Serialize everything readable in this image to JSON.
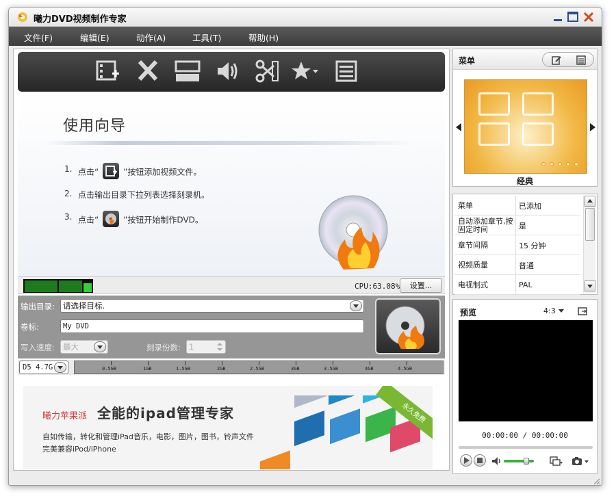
{
  "window": {
    "title": "曦力DVD视频制作专家"
  },
  "menubar": {
    "items": [
      {
        "label": "文件(F)"
      },
      {
        "label": "编辑(E)"
      },
      {
        "label": "动作(A)"
      },
      {
        "label": "工具(T)"
      },
      {
        "label": "帮助(H)"
      }
    ]
  },
  "toolbar": {
    "icons": [
      "add-video-icon",
      "delete-icon",
      "subtitle-icon",
      "audio-icon",
      "clip-icon",
      "effect-icon",
      "chapter-list-icon"
    ]
  },
  "guide": {
    "title": "使用向导",
    "steps": [
      {
        "num": "1.",
        "before": "点击“",
        "after": "”按钮添加视频文件。"
      },
      {
        "num": "2.",
        "text": "点击输出目录下拉列表选择刻录机。"
      },
      {
        "num": "3.",
        "before": "点击“",
        "after": "”按钮开始制作DVD。"
      }
    ]
  },
  "status": {
    "cpu_label": "CPU:63.08%",
    "settings_label": "设置..."
  },
  "output": {
    "dir_label": "输出目录:",
    "dir_value": "请选择目标.",
    "volume_label": "卷标:",
    "volume_value": "My DVD",
    "speed_label": "写入速度:",
    "speed_value": "最大",
    "copies_label": "刻录份数:",
    "copies_value": "1"
  },
  "capacity": {
    "disc_type": "D5 4.7G",
    "ticks": [
      "0.5GB",
      "1GB",
      "1.5GB",
      "2GB",
      "2.5GB",
      "3GB",
      "3.5GB",
      "4GB",
      "4.5GB"
    ]
  },
  "ad": {
    "brand": "曦力苹果派",
    "headline": "全能的ipad管理专家",
    "line1": "自如传输，转化和管理iPad音乐，电影，图片，图书，铃声文件",
    "line2": "完美兼容iPod/iPhone",
    "ribbon": "永久免费"
  },
  "menu_panel": {
    "title": "菜单",
    "template_name": "经典"
  },
  "settings_table": {
    "rows": [
      {
        "key": "菜单",
        "value": "已添加"
      },
      {
        "key": "自动添加章节,按固定时间",
        "value": "是"
      },
      {
        "key": "章节间隔",
        "value": "15 分钟"
      },
      {
        "key": "视频质量",
        "value": "普通"
      },
      {
        "key": "电视制式",
        "value": "PAL"
      }
    ]
  },
  "preview": {
    "title": "预览",
    "aspect": "4:3",
    "timecode": "00:00:00 / 00:00:00",
    "volume_level": 0.75
  },
  "colors": {
    "menubar": "#3c3c3c",
    "toolbar": "#262626",
    "accent_green": "#3bb03b",
    "ad_brand": "#d23a3a"
  }
}
